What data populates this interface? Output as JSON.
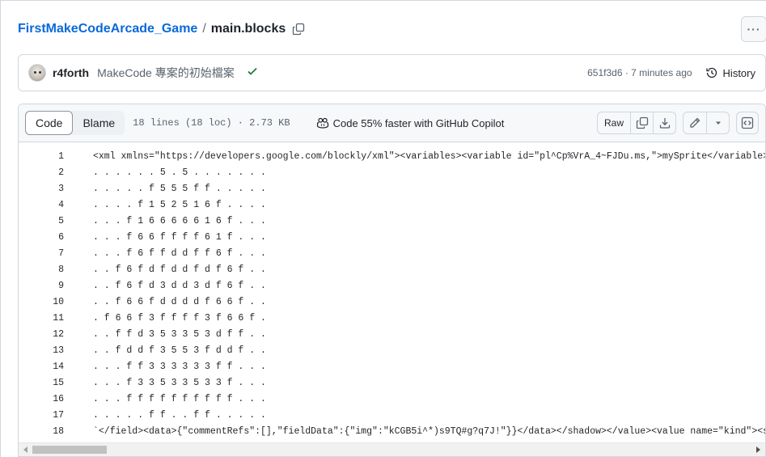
{
  "breadcrumb": {
    "repo": "FirstMakeCodeArcade_Game",
    "separator": "/",
    "file": "main.blocks"
  },
  "more_label": "···",
  "commit": {
    "author": "r4forth",
    "message": "MakeCode 專案的初始檔案",
    "status": "success",
    "sha_time": "651f3d6 · 7 minutes ago",
    "history_label": "History"
  },
  "file_header": {
    "tab_code": "Code",
    "tab_blame": "Blame",
    "meta": "18 lines (18 loc) · 2.73 KB",
    "copilot": "Code 55% faster with GitHub Copilot",
    "raw": "Raw"
  },
  "icons": {
    "copy": "copy-icon",
    "check": "check-icon",
    "history": "history-icon",
    "copilot": "copilot-icon",
    "download": "download-icon",
    "edit": "pencil-icon",
    "dropdown": "triangle-down-icon",
    "symbols": "code-square-icon"
  },
  "code_lines": [
    {
      "n": "1",
      "text": "<xml xmlns=\"https://developers.google.com/blockly/xml\"><variables><variable id=\"pl^Cp%VrA_4~FJDu.ms,\">mySprite</variable><variable id=\"XYZ\">kind</variable></variables>"
    },
    {
      "n": "2",
      "text": ". . . . . . 5 . 5 . . . . . . ."
    },
    {
      "n": "3",
      "text": ". . . . . f 5 5 5 f f . . . . ."
    },
    {
      "n": "4",
      "text": ". . . . f 1 5 2 5 1 6 f . . . ."
    },
    {
      "n": "5",
      "text": ". . . f 1 6 6 6 6 6 1 6 f . . ."
    },
    {
      "n": "6",
      "text": ". . . f 6 6 f f f f 6 1 f . . ."
    },
    {
      "n": "7",
      "text": ". . . f 6 f f d d f f 6 f . . ."
    },
    {
      "n": "8",
      "text": ". . f 6 f d f d d f d f 6 f . ."
    },
    {
      "n": "9",
      "text": ". . f 6 f d 3 d d 3 d f 6 f . ."
    },
    {
      "n": "10",
      "text": ". . f 6 6 f d d d d f 6 6 f . ."
    },
    {
      "n": "11",
      "text": ". f 6 6 f 3 f f f f 3 f 6 6 f ."
    },
    {
      "n": "12",
      "text": ". . f f d 3 5 3 3 5 3 d f f . ."
    },
    {
      "n": "13",
      "text": ". . f d d f 3 5 5 3 f d d f . ."
    },
    {
      "n": "14",
      "text": ". . . f f 3 3 3 3 3 3 f f . . ."
    },
    {
      "n": "15",
      "text": ". . . f 3 3 5 3 3 5 3 3 f . . ."
    },
    {
      "n": "16",
      "text": ". . . f f f f f f f f f f . . ."
    },
    {
      "n": "17",
      "text": ". . . . . f f . . f f . . . . ."
    },
    {
      "n": "18",
      "text": "`</field><data>{\"commentRefs\":[],\"fieldData\":{\"img\":\"kCGB5i^*)s9TQ#g?q7J!\"}}</data></shadow></value><value name=\"kind\"><shadow type=\"spritekind\"></shadow></value>"
    }
  ]
}
